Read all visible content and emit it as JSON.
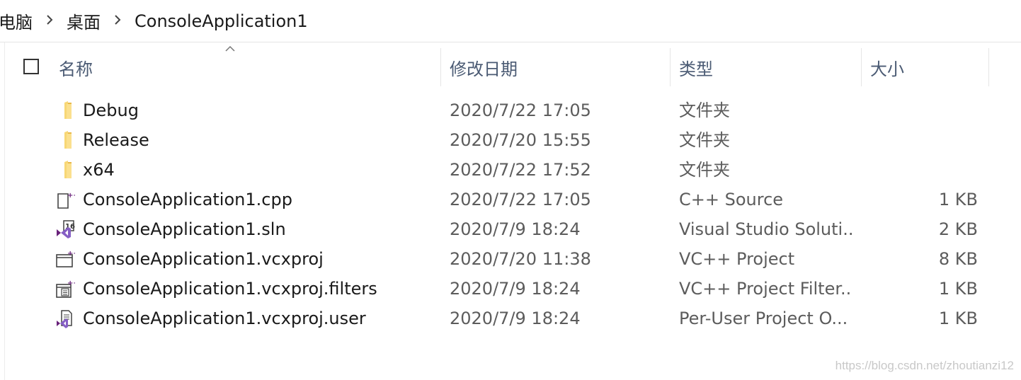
{
  "breadcrumb": {
    "items": [
      "电脑",
      "桌面",
      "ConsoleApplication1"
    ]
  },
  "columns": {
    "name": "名称",
    "date": "修改日期",
    "type": "类型",
    "size": "大小"
  },
  "rows": [
    {
      "icon": "folder-icon",
      "name": "Debug",
      "date": "2020/7/22 17:05",
      "type": "文件夹",
      "size": ""
    },
    {
      "icon": "folder-icon",
      "name": "Release",
      "date": "2020/7/20 15:55",
      "type": "文件夹",
      "size": ""
    },
    {
      "icon": "folder-icon",
      "name": "x64",
      "date": "2020/7/22 17:52",
      "type": "文件夹",
      "size": ""
    },
    {
      "icon": "cpp-file-icon",
      "name": "ConsoleApplication1.cpp",
      "date": "2020/7/22 17:05",
      "type": "C++ Source",
      "size": "1 KB"
    },
    {
      "icon": "sln-file-icon",
      "name": "ConsoleApplication1.sln",
      "date": "2020/7/9 18:24",
      "type": "Visual Studio Soluti...",
      "size": "2 KB"
    },
    {
      "icon": "vcxproj-file-icon",
      "name": "ConsoleApplication1.vcxproj",
      "date": "2020/7/20 11:38",
      "type": "VC++ Project",
      "size": "8 KB"
    },
    {
      "icon": "filters-file-icon",
      "name": "ConsoleApplication1.vcxproj.filters",
      "date": "2020/7/9 18:24",
      "type": "VC++ Project Filter...",
      "size": "1 KB"
    },
    {
      "icon": "user-file-icon",
      "name": "ConsoleApplication1.vcxproj.user",
      "date": "2020/7/9 18:24",
      "type": "Per-User Project O...",
      "size": "1 KB"
    }
  ],
  "watermark": "https://blog.csdn.net/zhoutianzi12",
  "colors": {
    "folder": "#f8d775",
    "vs_purple": "#68217a",
    "header_text": "#4a5a73"
  }
}
